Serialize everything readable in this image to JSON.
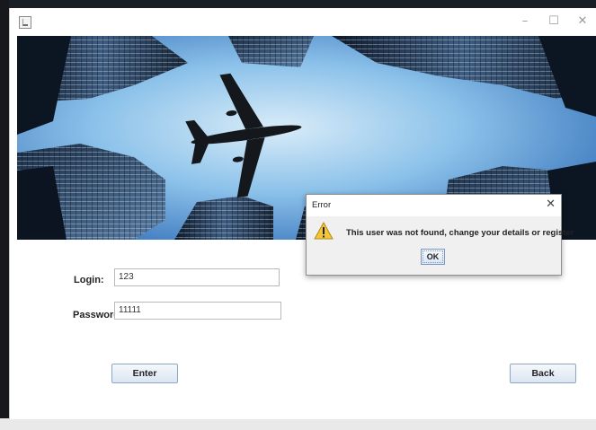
{
  "window": {
    "controls": {
      "minimize": "–",
      "maximize": "☐",
      "close": "✕"
    }
  },
  "form": {
    "login_label": "Login:",
    "login_value": "123",
    "password_label": "Password:",
    "password_value": "11111",
    "enter_label": "Enter",
    "back_label": "Back"
  },
  "dialog": {
    "title": "Error",
    "close": "✕",
    "message": "This user was not found, change your details or register",
    "ok_label": "OK",
    "icon": "warning-icon"
  },
  "colors": {
    "sky_top": "#2d6fc0",
    "sky_bottom": "#bcdcf2",
    "button_border": "#8ea6c6",
    "warning": "#f3c53a"
  }
}
